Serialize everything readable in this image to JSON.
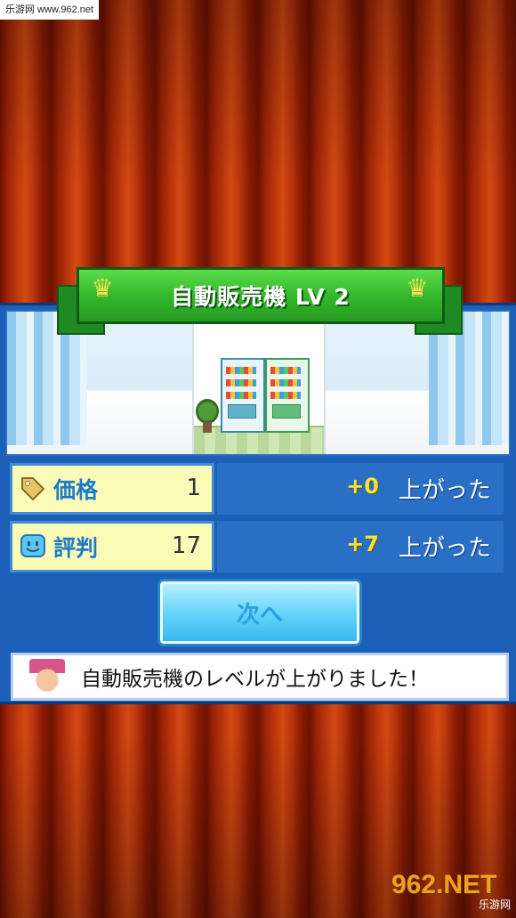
{
  "watermark_top": "乐游网 www.962.net",
  "banner": {
    "title": "自動販売機 LV 2",
    "left_icon": "crown-icon",
    "right_icon": "crown-icon"
  },
  "stats": [
    {
      "icon": "price-tag-icon",
      "label": "価格",
      "value": "1",
      "delta": "+0",
      "result": "上がった"
    },
    {
      "icon": "smile-face-icon",
      "label": "評判",
      "value": "17",
      "delta": "+7",
      "result": "上がった"
    }
  ],
  "next_button": {
    "label": "次へ"
  },
  "message": {
    "text": "自動販売機のレベルが上がりました！"
  },
  "watermark_bottom": {
    "big": "962.NET",
    "small": "乐游网"
  },
  "colors": {
    "panel_blue": "#1b5fb8",
    "banner_green": "#34b82c",
    "delta_yellow": "#f7e23a",
    "stat_box": "#fbfbb8"
  }
}
